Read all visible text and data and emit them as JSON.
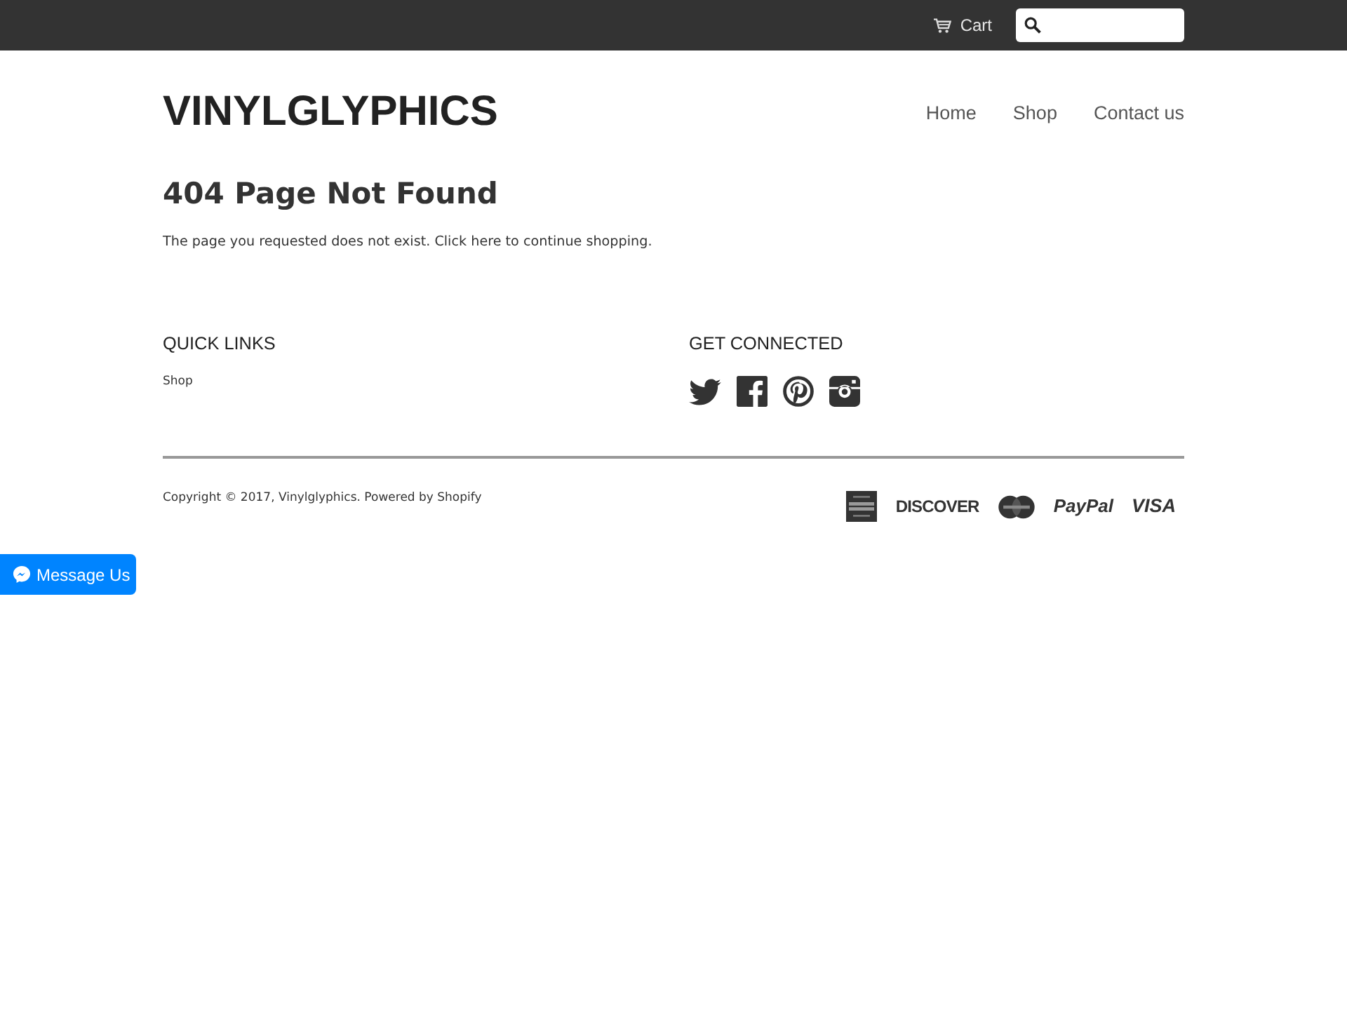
{
  "top_bar": {
    "cart": "Cart"
  },
  "header": {
    "logo": "VINYLGLYPHICS",
    "nav": [
      {
        "label": "Home"
      },
      {
        "label": "Shop"
      },
      {
        "label": "Contact us"
      }
    ]
  },
  "main": {
    "title": "404 Page Not Found",
    "message": {
      "before": "The page you requested does not exist. Click ",
      "link": "here",
      "after": " to continue shopping."
    }
  },
  "footer": {
    "quick_links": {
      "heading": "QUICK LINKS",
      "links": [
        "Shop"
      ]
    },
    "get_connected": {
      "heading": "GET CONNECTED",
      "social": [
        {
          "kind": "twitter"
        },
        {
          "kind": "facebook"
        },
        {
          "kind": "pinterest"
        },
        {
          "kind": "instagram"
        }
      ]
    },
    "copyright": "Copyright © 2017, Vinylglyphics. Powered by Shopify",
    "payments": [
      {
        "kind": "amex"
      },
      {
        "kind": "wordmark",
        "text": "DISCOVER"
      },
      {
        "kind": "mastercard"
      },
      {
        "kind": "wordmark",
        "text": "PayPal"
      },
      {
        "kind": "wordmark",
        "text": "VISA"
      }
    ]
  },
  "chat_button": {
    "label": "Message Us"
  }
}
